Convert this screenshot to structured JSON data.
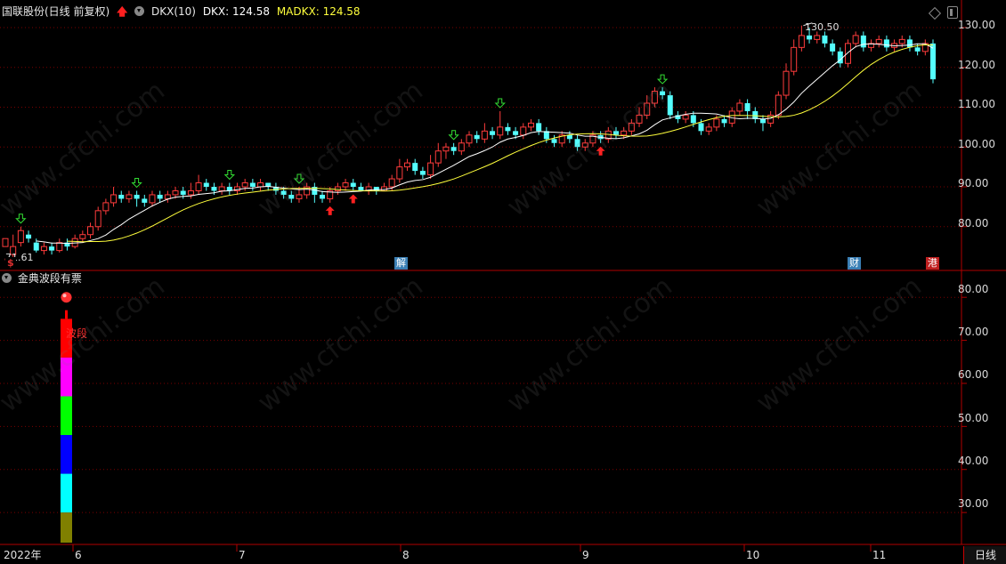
{
  "header": {
    "stock_title": "国联股份(日线 前复权)",
    "indicator_name": "DKX(10)",
    "dkx_label": "DKX: 124.58",
    "madkx_label": "MADKX: 124.58",
    "arrow_icon": "red-up-arrow-icon",
    "dropdown_icon": "chevron-down-icon"
  },
  "lower_panel": {
    "indicator_name": "金典波段有票",
    "band_label": "波段"
  },
  "price_axis": [
    "130.00",
    "120.00",
    "110.00",
    "100.00",
    "90.00",
    "80.00"
  ],
  "lower_axis": [
    "80.00",
    "70.00",
    "60.00",
    "50.00",
    "40.00",
    "30.00"
  ],
  "dates": [
    "2022年",
    "6",
    "7",
    "8",
    "9",
    "10",
    "11"
  ],
  "period_button": "日线",
  "price_labels": {
    "high": "130.50",
    "low": "71.61"
  },
  "event_tags": [
    {
      "text": "$",
      "color": "#e03030"
    },
    {
      "text": "解",
      "color": "#3a7fb5"
    },
    {
      "text": "财",
      "color": "#3a7fb5"
    },
    {
      "text": "港",
      "color": "#c02020"
    }
  ],
  "watermark": "www.cfchi.com",
  "colors": {
    "up": "#ff3c3c",
    "down": "#54ffff",
    "dkx_line": "#ffffff",
    "madkx_line": "#ffff3c",
    "grid": "#8b0000",
    "band_colors": [
      "#ff0000",
      "#ff00ff",
      "#00ff00",
      "#0000ff",
      "#00ffff",
      "#808000"
    ]
  },
  "chart_data": {
    "type": "candlestick",
    "y_range": [
      69,
      132
    ],
    "candles": [
      [
        75,
        77,
        72,
        71.6
      ],
      [
        73,
        75,
        78,
        72
      ],
      [
        76,
        79,
        80,
        75
      ],
      [
        78,
        77,
        79,
        76
      ],
      [
        76,
        74,
        77,
        73.5
      ],
      [
        74,
        75,
        76,
        73
      ],
      [
        75,
        74,
        76,
        73
      ],
      [
        74,
        76,
        77,
        73.5
      ],
      [
        76,
        75,
        77,
        74
      ],
      [
        75,
        77,
        78,
        74.5
      ],
      [
        77,
        78,
        79,
        76
      ],
      [
        78,
        80,
        81,
        77
      ],
      [
        80,
        84,
        85,
        79
      ],
      [
        84,
        86,
        87,
        83
      ],
      [
        86,
        88,
        90,
        85
      ],
      [
        88,
        87,
        89,
        86
      ],
      [
        87,
        88,
        89,
        86
      ],
      [
        88,
        87,
        89,
        85
      ],
      [
        87,
        86,
        88,
        85
      ],
      [
        86,
        88,
        89,
        85
      ],
      [
        88,
        87,
        89,
        86
      ],
      [
        87,
        88,
        89,
        86
      ],
      [
        88,
        89,
        90,
        87
      ],
      [
        89,
        88,
        90,
        87
      ],
      [
        88,
        89,
        91,
        87
      ],
      [
        89,
        91,
        93,
        88
      ],
      [
        91,
        90,
        92,
        89
      ],
      [
        90,
        89,
        91,
        88
      ],
      [
        89,
        90,
        91,
        88
      ],
      [
        90,
        89,
        91,
        88
      ],
      [
        89,
        90,
        91,
        88
      ],
      [
        90,
        91,
        92,
        89
      ],
      [
        91,
        90,
        92,
        89
      ],
      [
        90,
        91,
        92,
        89
      ],
      [
        91,
        90,
        91,
        89
      ],
      [
        90,
        89,
        91,
        88
      ],
      [
        89,
        88,
        90,
        87
      ],
      [
        88,
        87,
        89,
        86
      ],
      [
        87,
        88,
        90,
        86
      ],
      [
        88,
        90,
        91,
        87
      ],
      [
        90,
        88,
        91,
        86
      ],
      [
        88,
        87,
        89,
        86
      ],
      [
        87,
        89,
        90,
        86
      ],
      [
        89,
        90,
        91,
        88
      ],
      [
        90,
        91,
        92,
        89
      ],
      [
        91,
        90,
        92,
        89
      ],
      [
        90,
        89,
        91,
        89
      ],
      [
        89,
        90,
        91,
        88
      ],
      [
        90,
        89,
        90,
        88
      ],
      [
        89,
        90,
        91,
        89
      ],
      [
        90,
        92,
        93,
        89
      ],
      [
        92,
        95,
        97,
        91
      ],
      [
        95,
        96,
        97,
        94
      ],
      [
        96,
        94,
        97,
        93
      ],
      [
        94,
        93,
        95,
        92
      ],
      [
        93,
        96,
        98,
        92
      ],
      [
        96,
        99,
        101,
        95
      ],
      [
        99,
        100,
        101,
        97
      ],
      [
        100,
        99,
        101,
        98
      ],
      [
        99,
        101,
        102,
        98
      ],
      [
        101,
        103,
        104,
        100
      ],
      [
        103,
        102,
        104,
        101
      ],
      [
        102,
        104,
        106,
        101
      ],
      [
        104,
        103,
        105,
        102
      ],
      [
        103,
        105,
        109,
        102
      ],
      [
        105,
        104,
        106,
        103
      ],
      [
        104,
        103,
        105,
        102
      ],
      [
        103,
        105,
        106,
        102
      ],
      [
        105,
        106,
        107,
        104
      ],
      [
        106,
        104,
        107,
        103
      ],
      [
        104,
        102,
        105,
        101
      ],
      [
        102,
        101,
        103,
        100
      ],
      [
        101,
        103,
        104,
        100
      ],
      [
        103,
        102,
        104,
        101
      ],
      [
        102,
        100,
        103,
        99
      ],
      [
        100,
        101,
        102,
        99
      ],
      [
        101,
        103,
        104,
        100
      ],
      [
        103,
        102,
        104,
        101
      ],
      [
        102,
        104,
        105,
        101
      ],
      [
        104,
        103,
        105,
        102
      ],
      [
        103,
        104,
        105,
        102
      ],
      [
        104,
        106,
        107,
        103
      ],
      [
        106,
        108,
        110,
        105
      ],
      [
        108,
        111,
        113,
        107
      ],
      [
        111,
        114,
        115,
        110
      ],
      [
        114,
        113,
        115,
        112
      ],
      [
        113,
        108,
        114,
        107
      ],
      [
        108,
        107,
        109,
        106
      ],
      [
        107,
        108,
        109,
        106
      ],
      [
        108,
        106,
        109,
        105
      ],
      [
        106,
        104,
        107,
        103
      ],
      [
        104,
        105,
        106,
        103
      ],
      [
        105,
        107,
        108,
        104
      ],
      [
        107,
        106,
        108,
        105
      ],
      [
        106,
        109,
        110,
        105
      ],
      [
        109,
        111,
        112,
        108
      ],
      [
        111,
        109,
        112,
        107
      ],
      [
        109,
        107,
        110,
        106
      ],
      [
        107,
        106,
        108,
        104
      ],
      [
        106,
        108,
        109,
        105
      ],
      [
        108,
        113,
        114,
        107
      ],
      [
        113,
        119,
        121,
        112
      ],
      [
        119,
        125,
        127,
        118
      ],
      [
        125,
        128,
        130.5,
        124
      ],
      [
        128,
        127,
        130,
        126
      ],
      [
        127,
        128,
        129,
        126
      ],
      [
        128,
        126,
        129,
        125
      ],
      [
        126,
        124,
        127,
        123
      ],
      [
        124,
        121,
        125,
        120
      ],
      [
        121,
        126,
        127,
        120
      ],
      [
        126,
        128,
        129,
        125
      ],
      [
        128,
        125,
        129,
        124
      ],
      [
        125,
        126,
        127,
        124
      ],
      [
        126,
        127,
        128,
        125
      ],
      [
        127,
        125,
        128,
        124
      ],
      [
        125,
        126,
        127,
        124
      ],
      [
        126,
        127,
        128,
        125
      ],
      [
        127,
        125,
        128,
        124
      ],
      [
        125,
        124,
        126,
        123
      ],
      [
        124,
        126,
        127,
        123
      ],
      [
        126,
        117,
        127,
        116
      ]
    ],
    "dkx_start": 73,
    "madkx_start": 71.6,
    "last_dkx": 124.58,
    "last_madkx": 124.58
  }
}
